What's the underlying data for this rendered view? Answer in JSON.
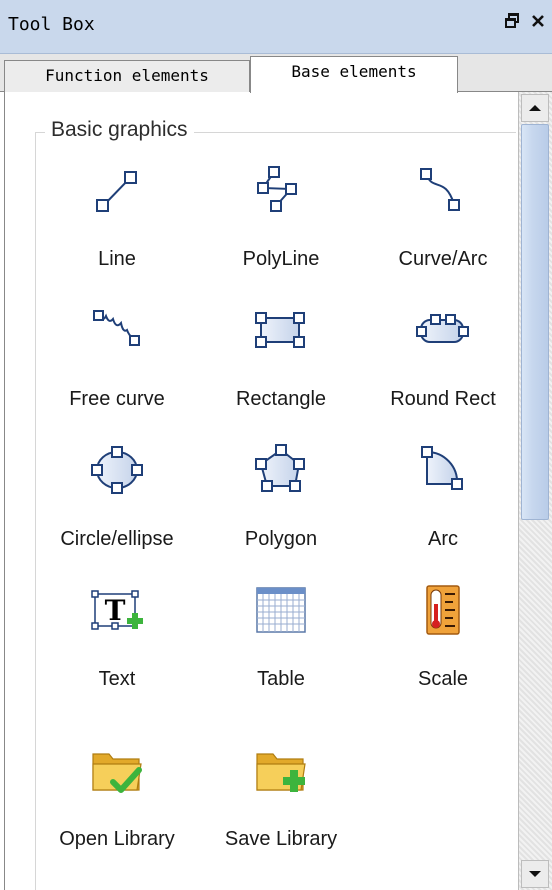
{
  "window": {
    "title": "Tool Box",
    "restore_icon": "restore-window-icon",
    "close_icon": "close-icon"
  },
  "tabs": [
    {
      "label": "Function elements",
      "active": false
    },
    {
      "label": "Base elements",
      "active": true
    }
  ],
  "group": {
    "title": "Basic graphics"
  },
  "items": [
    {
      "label": "Line",
      "icon": "line-icon"
    },
    {
      "label": "PolyLine",
      "icon": "polyline-icon"
    },
    {
      "label": "Curve/Arc",
      "icon": "curve-arc-icon"
    },
    {
      "label": "Free curve",
      "icon": "free-curve-icon"
    },
    {
      "label": "Rectangle",
      "icon": "rectangle-icon"
    },
    {
      "label": "Round Rect",
      "icon": "round-rect-icon"
    },
    {
      "label": "Circle/ellipse",
      "icon": "circle-ellipse-icon"
    },
    {
      "label": "Polygon",
      "icon": "polygon-icon"
    },
    {
      "label": "Arc",
      "icon": "arc-icon"
    },
    {
      "label": "Text",
      "icon": "text-icon"
    },
    {
      "label": "Table",
      "icon": "table-icon"
    },
    {
      "label": "Scale",
      "icon": "scale-icon"
    },
    {
      "label": "Open Library",
      "icon": "open-library-icon"
    },
    {
      "label": "Save Library",
      "icon": "save-library-icon"
    }
  ],
  "colors": {
    "titlebar": "#c9d8ec",
    "handle_fill": "#ffffff",
    "handle_stroke": "#1f3f78",
    "folder": "#f2c23a",
    "check": "#3db43d"
  }
}
